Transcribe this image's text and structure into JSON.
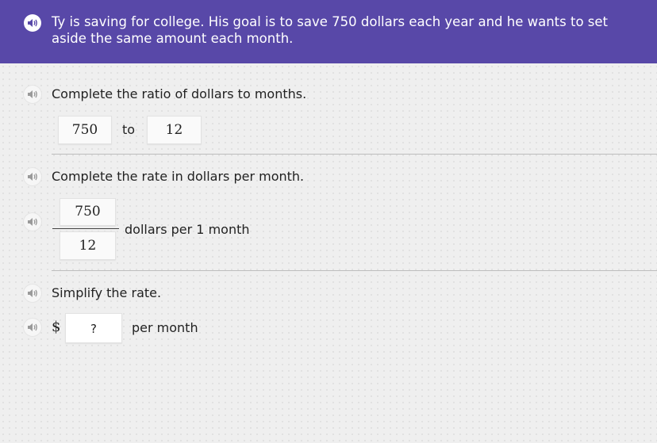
{
  "problem": {
    "prompt": "Ty is saving for college. His goal is to save 750 dollars each year and he wants to set aside the same amount each month."
  },
  "ratio_step": {
    "instruction": "Complete the ratio of dollars to months.",
    "left_value": "750",
    "connector": "to",
    "right_value": "12"
  },
  "rate_step": {
    "instruction": "Complete the rate in dollars per month.",
    "numerator": "750",
    "denominator": "12",
    "suffix": "dollars per 1 month"
  },
  "simplify_step": {
    "instruction": "Simplify the rate.",
    "currency_symbol": "$",
    "answer_placeholder": "?",
    "suffix": "per month"
  },
  "colors": {
    "header_bg": "#5848a8",
    "header_text": "#ffffff",
    "page_bg": "#efefef",
    "divider": "#bdbdbd"
  },
  "icons": {
    "audio": "speaker-icon"
  }
}
